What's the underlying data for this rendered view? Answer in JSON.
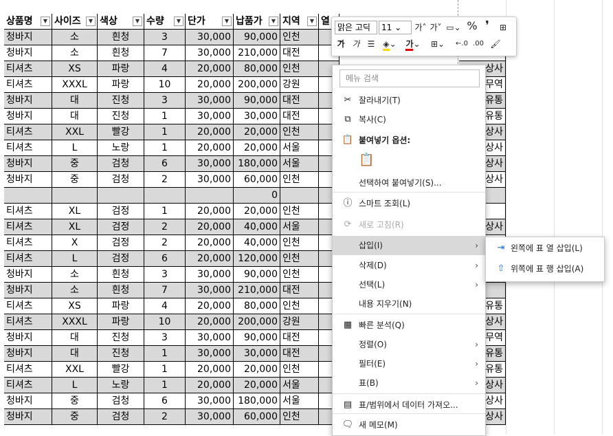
{
  "columns": [
    "상품명",
    "사이즈",
    "색상",
    "수량",
    "단가",
    "납품가",
    "지역",
    "열"
  ],
  "rows": [
    [
      "청바지",
      "소",
      "흰청",
      "3",
      "30,000",
      "90,000",
      "인천"
    ],
    [
      "청바지",
      "소",
      "흰청",
      "7",
      "30,000",
      "210,000",
      "대전"
    ],
    [
      "티셔츠",
      "XS",
      "파랑",
      "4",
      "20,000",
      "80,000",
      "인천"
    ],
    [
      "티셔츠",
      "XXXL",
      "파랑",
      "10",
      "20,000",
      "200,000",
      "강원"
    ],
    [
      "청바지",
      "대",
      "진청",
      "3",
      "30,000",
      "90,000",
      "대전"
    ],
    [
      "청바지",
      "대",
      "진청",
      "1",
      "30,000",
      "30,000",
      "대전"
    ],
    [
      "티셔츠",
      "XXL",
      "빨강",
      "1",
      "20,000",
      "20,000",
      "인천"
    ],
    [
      "티셔츠",
      "L",
      "노랑",
      "1",
      "20,000",
      "20,000",
      "서울"
    ],
    [
      "청바지",
      "중",
      "검청",
      "6",
      "30,000",
      "180,000",
      "서울"
    ],
    [
      "청바지",
      "중",
      "검청",
      "2",
      "30,000",
      "60,000",
      "인천"
    ],
    [
      "",
      "",
      "",
      "",
      "",
      "0",
      ""
    ],
    [
      "티셔츠",
      "XL",
      "검정",
      "1",
      "20,000",
      "20,000",
      "인천"
    ],
    [
      "티셔츠",
      "XL",
      "검정",
      "2",
      "20,000",
      "40,000",
      "서울"
    ],
    [
      "티셔츠",
      "X",
      "검정",
      "2",
      "20,000",
      "40,000",
      "인천"
    ],
    [
      "티셔츠",
      "L",
      "검정",
      "6",
      "20,000",
      "120,000",
      "인천"
    ],
    [
      "청바지",
      "소",
      "흰청",
      "3",
      "30,000",
      "90,000",
      "인천"
    ],
    [
      "청바지",
      "소",
      "흰청",
      "7",
      "30,000",
      "210,000",
      "대전"
    ],
    [
      "티셔츠",
      "XS",
      "파랑",
      "4",
      "20,000",
      "80,000",
      "인천"
    ],
    [
      "티셔츠",
      "XXXL",
      "파랑",
      "10",
      "20,000",
      "200,000",
      "강원"
    ],
    [
      "청바지",
      "대",
      "진청",
      "3",
      "30,000",
      "90,000",
      "대전"
    ],
    [
      "청바지",
      "대",
      "진청",
      "1",
      "30,000",
      "30,000",
      "대전"
    ],
    [
      "티셔츠",
      "XXL",
      "빨강",
      "1",
      "20,000",
      "20,000",
      "인천"
    ],
    [
      "티셔츠",
      "L",
      "노랑",
      "1",
      "20,000",
      "20,000",
      "서울"
    ],
    [
      "청바지",
      "중",
      "검청",
      "6",
      "30,000",
      "180,000",
      "서울"
    ],
    [
      "청바지",
      "중",
      "검청",
      "2",
      "30,000",
      "60,000",
      "인천"
    ]
  ],
  "right_col": [
    "",
    "",
    "상사",
    "무역",
    "유통",
    "유통",
    "상사",
    "상사",
    "상사",
    "상사",
    "",
    "",
    "상사",
    "",
    "",
    "",
    "",
    "유통",
    "상사",
    "무역",
    "유통",
    "유통",
    "상사",
    "상사",
    "상사"
  ],
  "mini_toolbar": {
    "font": "맑은 고딕",
    "size": "11",
    "grow": "가",
    "shrink": "가",
    "percent": "%",
    "comma": "❜",
    "bold": "가",
    "italic": "가"
  },
  "context_menu": {
    "search_placeholder": "메뉴 검색",
    "items": [
      {
        "label": "잘라내기(T)",
        "icon": "✂"
      },
      {
        "label": "복사(C)",
        "icon": "⧉"
      },
      {
        "label": "붙여넣기 옵션:",
        "icon": "📋"
      },
      {
        "label": "선택하여 붙여넣기(S)...",
        "icon": ""
      },
      {
        "label": "스마트 조회(L)",
        "icon": "ⓘ"
      },
      {
        "label": "새로 고침(R)",
        "icon": "⟳"
      },
      {
        "label": "삽입(I)",
        "icon": ""
      },
      {
        "label": "삭제(D)",
        "icon": ""
      },
      {
        "label": "선택(L)",
        "icon": ""
      },
      {
        "label": "내용 지우기(N)",
        "icon": ""
      },
      {
        "label": "빠른 분석(Q)",
        "icon": "▦"
      },
      {
        "label": "정렬(O)",
        "icon": ""
      },
      {
        "label": "필터(E)",
        "icon": ""
      },
      {
        "label": "표(B)",
        "icon": ""
      },
      {
        "label": "표/범위에서 데이터 가져오...",
        "icon": "▤"
      },
      {
        "label": "새 메모(M)",
        "icon": "🗨"
      }
    ]
  },
  "submenu": {
    "items": [
      {
        "label": "왼쪽에 표 열 삽입(L)"
      },
      {
        "label": "위쪽에 표 행 삽입(A)"
      }
    ]
  }
}
